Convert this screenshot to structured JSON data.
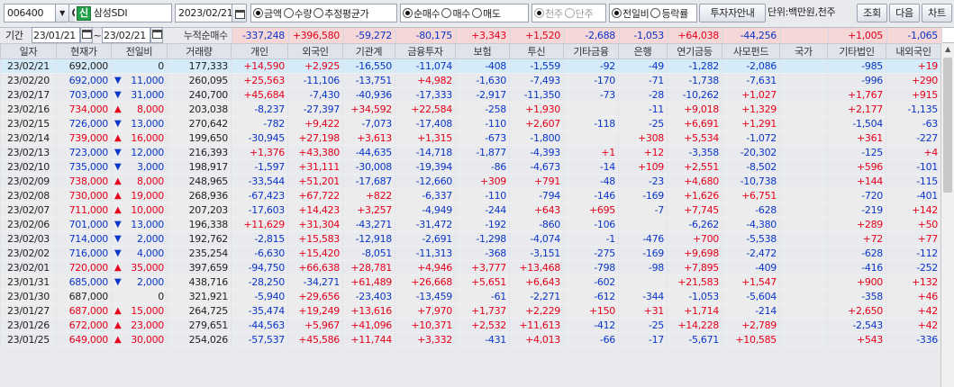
{
  "toolbar": {
    "code": "006400",
    "shin": "신",
    "name": "삼성SDI",
    "date": "2023/02/21",
    "radio_a": [
      "금액",
      "수량",
      "추정평균가"
    ],
    "radio_b": [
      "순매수",
      "매수",
      "매도"
    ],
    "radio_c": [
      "천주",
      "단주"
    ],
    "radio_d": [
      "전일비",
      "등락률"
    ],
    "investor_btn": "투자자안내",
    "unit": "단위:백만원,천주",
    "btn_search": "조회",
    "btn_next": "다음",
    "btn_chart": "차트"
  },
  "period": {
    "label": "기간",
    "start": "23/01/21",
    "tilde": "~",
    "end": "23/02/21",
    "sum_label": "누적순매수",
    "sums": [
      "-337,248",
      "+396,580",
      "-59,272",
      "-80,175",
      "+3,343",
      "+1,520",
      "-2,688",
      "-1,053",
      "+64,038",
      "-44,256",
      "",
      "+1,005",
      "-1,065"
    ]
  },
  "headers": [
    "일자",
    "현재가",
    "전일비",
    "거래량",
    "개인",
    "외국인",
    "기관계",
    "금융투자",
    "보험",
    "투신",
    "기타금융",
    "은행",
    "연기금등",
    "사모펀드",
    "국가",
    "기타법인",
    "내외국인"
  ],
  "rows": [
    [
      "23/02/21",
      "692,000",
      "",
      "0",
      "177,333",
      "+14,590",
      "+2,925",
      "-16,550",
      "-11,074",
      "-408",
      "-1,559",
      "-92",
      "-49",
      "-1,282",
      "-2,086",
      "",
      "-985",
      "+19"
    ],
    [
      "23/02/20",
      "692,000",
      "d",
      "11,000",
      "260,095",
      "+25,563",
      "-11,106",
      "-13,751",
      "+4,982",
      "-1,630",
      "-7,493",
      "-170",
      "-71",
      "-1,738",
      "-7,631",
      "",
      "-996",
      "+290"
    ],
    [
      "23/02/17",
      "703,000",
      "d",
      "31,000",
      "240,700",
      "+45,684",
      "-7,430",
      "-40,936",
      "-17,333",
      "-2,917",
      "-11,350",
      "-73",
      "-28",
      "-10,262",
      "+1,027",
      "",
      "+1,767",
      "+915"
    ],
    [
      "23/02/16",
      "734,000",
      "u",
      "8,000",
      "203,038",
      "-8,237",
      "-27,397",
      "+34,592",
      "+22,584",
      "-258",
      "+1,930",
      "",
      "-11",
      "+9,018",
      "+1,329",
      "",
      "+2,177",
      "-1,135"
    ],
    [
      "23/02/15",
      "726,000",
      "d",
      "13,000",
      "270,642",
      "-782",
      "+9,422",
      "-7,073",
      "-17,408",
      "-110",
      "+2,607",
      "-118",
      "-25",
      "+6,691",
      "+1,291",
      "",
      "-1,504",
      "-63"
    ],
    [
      "23/02/14",
      "739,000",
      "u",
      "16,000",
      "199,650",
      "-30,945",
      "+27,198",
      "+3,613",
      "+1,315",
      "-673",
      "-1,800",
      "",
      "+308",
      "+5,534",
      "-1,072",
      "",
      "+361",
      "-227"
    ],
    [
      "23/02/13",
      "723,000",
      "d",
      "12,000",
      "216,393",
      "+1,376",
      "+43,380",
      "-44,635",
      "-14,718",
      "-1,877",
      "-4,393",
      "+1",
      "+12",
      "-3,358",
      "-20,302",
      "",
      "-125",
      "+4"
    ],
    [
      "23/02/10",
      "735,000",
      "d",
      "3,000",
      "198,917",
      "-1,597",
      "+31,111",
      "-30,008",
      "-19,394",
      "-86",
      "-4,673",
      "-14",
      "+109",
      "+2,551",
      "-8,502",
      "",
      "+596",
      "-101"
    ],
    [
      "23/02/09",
      "738,000",
      "u",
      "8,000",
      "248,965",
      "-33,544",
      "+51,201",
      "-17,687",
      "-12,660",
      "+309",
      "+791",
      "-48",
      "-23",
      "+4,680",
      "-10,738",
      "",
      "+144",
      "-115"
    ],
    [
      "23/02/08",
      "730,000",
      "u",
      "19,000",
      "268,936",
      "-67,423",
      "+67,722",
      "+822",
      "-6,337",
      "-110",
      "-794",
      "-146",
      "-169",
      "+1,626",
      "+6,751",
      "",
      "-720",
      "-401"
    ],
    [
      "23/02/07",
      "711,000",
      "u",
      "10,000",
      "207,203",
      "-17,603",
      "+14,423",
      "+3,257",
      "-4,949",
      "-244",
      "+643",
      "+695",
      "-7",
      "+7,745",
      "-628",
      "",
      "-219",
      "+142"
    ],
    [
      "23/02/06",
      "701,000",
      "d",
      "13,000",
      "196,338",
      "+11,629",
      "+31,304",
      "-43,271",
      "-31,472",
      "-192",
      "-860",
      "-106",
      "",
      "-6,262",
      "-4,380",
      "",
      "+289",
      "+50"
    ],
    [
      "23/02/03",
      "714,000",
      "d",
      "2,000",
      "192,762",
      "-2,815",
      "+15,583",
      "-12,918",
      "-2,691",
      "-1,298",
      "-4,074",
      "-1",
      "-476",
      "+700",
      "-5,538",
      "",
      "+72",
      "+77"
    ],
    [
      "23/02/02",
      "716,000",
      "d",
      "4,000",
      "235,254",
      "-6,630",
      "+15,420",
      "-8,051",
      "-11,313",
      "-368",
      "-3,151",
      "-275",
      "-169",
      "+9,698",
      "-2,472",
      "",
      "-628",
      "-112"
    ],
    [
      "23/02/01",
      "720,000",
      "u",
      "35,000",
      "397,659",
      "-94,750",
      "+66,638",
      "+28,781",
      "+4,946",
      "+3,777",
      "+13,468",
      "-798",
      "-98",
      "+7,895",
      "-409",
      "",
      "-416",
      "-252"
    ],
    [
      "23/01/31",
      "685,000",
      "d",
      "2,000",
      "438,716",
      "-28,250",
      "-34,271",
      "+61,489",
      "+26,668",
      "+5,651",
      "+6,643",
      "-602",
      "",
      "+21,583",
      "+1,547",
      "",
      "+900",
      "+132"
    ],
    [
      "23/01/30",
      "687,000",
      "",
      "0",
      "321,921",
      "-5,940",
      "+29,656",
      "-23,403",
      "-13,459",
      "-61",
      "-2,271",
      "-612",
      "-344",
      "-1,053",
      "-5,604",
      "",
      "-358",
      "+46"
    ],
    [
      "23/01/27",
      "687,000",
      "u",
      "15,000",
      "264,725",
      "-35,474",
      "+19,249",
      "+13,616",
      "+7,970",
      "+1,737",
      "+2,229",
      "+150",
      "+31",
      "+1,714",
      "-214",
      "",
      "+2,650",
      "+42"
    ],
    [
      "23/01/26",
      "672,000",
      "u",
      "23,000",
      "279,651",
      "-44,563",
      "+5,967",
      "+41,096",
      "+10,371",
      "+2,532",
      "+11,613",
      "-412",
      "-25",
      "+14,228",
      "+2,789",
      "",
      "-2,543",
      "+42"
    ],
    [
      "23/01/25",
      "649,000",
      "u",
      "30,000",
      "254,026",
      "-57,537",
      "+45,586",
      "+11,744",
      "+3,332",
      "-431",
      "+4,013",
      "-66",
      "-17",
      "-5,671",
      "+10,585",
      "",
      "+543",
      "-336"
    ]
  ],
  "colors": {
    "up": "#e4001b",
    "down": "#0a35c8",
    "selected": "#d5ebf7",
    "sum_bg": "#f6d7d7"
  }
}
